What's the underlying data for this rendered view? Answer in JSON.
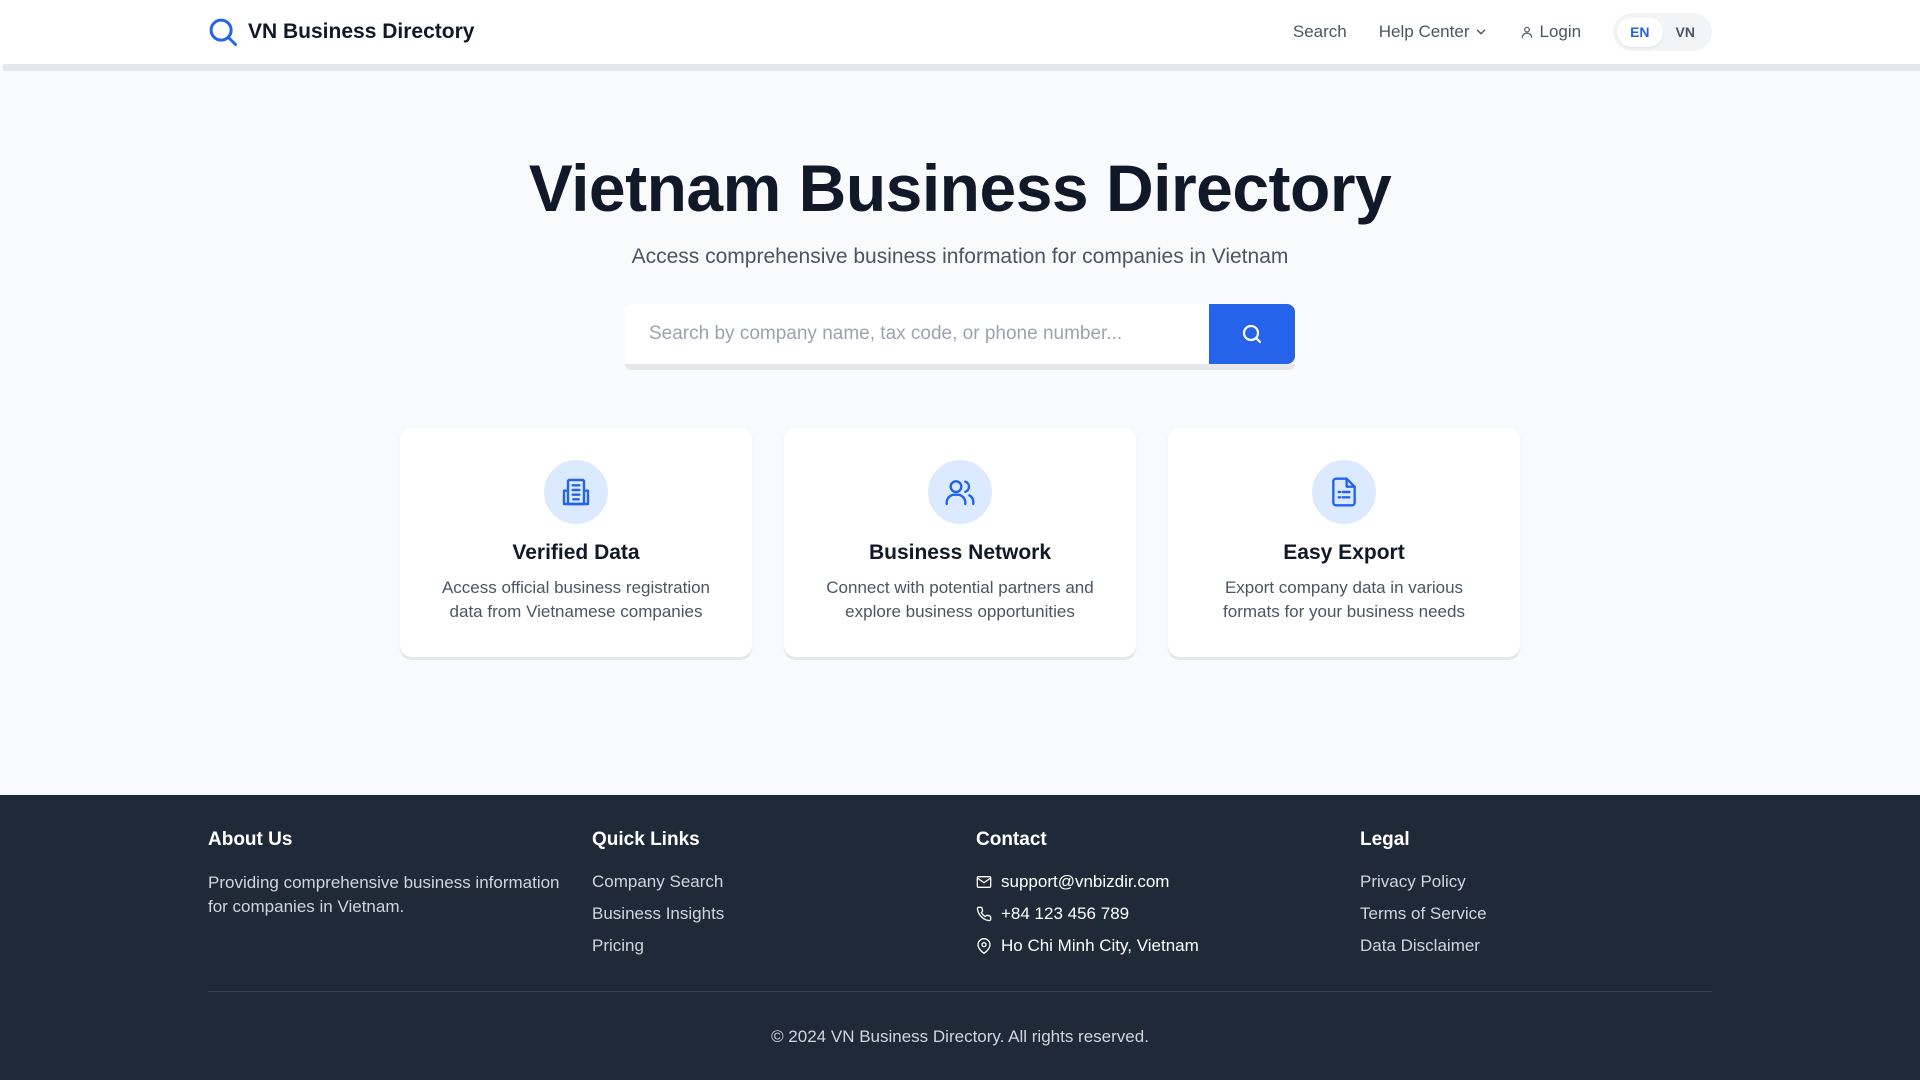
{
  "header": {
    "brand": "VN Business Directory",
    "nav": {
      "search": "Search",
      "help_center": "Help Center",
      "login": "Login"
    },
    "languages": [
      "EN",
      "VN"
    ],
    "active_language": "EN"
  },
  "hero": {
    "title": "Vietnam Business Directory",
    "subtitle": "Access comprehensive business information for companies in Vietnam",
    "search_placeholder": "Search by company name, tax code, or phone number..."
  },
  "features": [
    {
      "icon": "building-icon",
      "title": "Verified Data",
      "description": "Access official business registration data from Vietnamese companies"
    },
    {
      "icon": "users-icon",
      "title": "Business Network",
      "description": "Connect with potential partners and explore business opportunities"
    },
    {
      "icon": "document-icon",
      "title": "Easy Export",
      "description": "Export company data in various formats for your business needs"
    }
  ],
  "footer": {
    "about": {
      "heading": "About Us",
      "text": "Providing comprehensive business information for companies in Vietnam."
    },
    "quick_links": {
      "heading": "Quick Links",
      "items": [
        "Company Search",
        "Business Insights",
        "Pricing"
      ]
    },
    "contact": {
      "heading": "Contact",
      "email": "support@vnbizdir.com",
      "phone": "+84 123 456 789",
      "address": "Ho Chi Minh City, Vietnam"
    },
    "legal": {
      "heading": "Legal",
      "items": [
        "Privacy Policy",
        "Terms of Service",
        "Data Disclaimer"
      ]
    },
    "copyright": "© 2024 VN Business Directory. All rights reserved."
  },
  "colors": {
    "primary": "#2563eb",
    "icon_bg": "#dbeafe",
    "footer_bg": "#1f2937",
    "page_bg": "#f8fafc"
  }
}
